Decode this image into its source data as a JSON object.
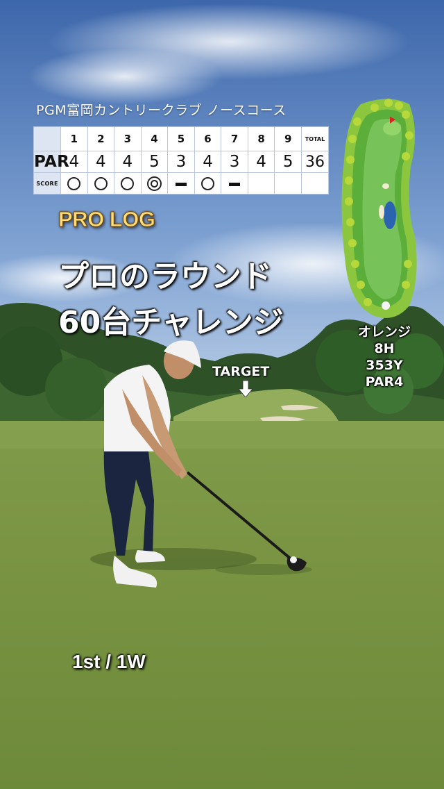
{
  "course": {
    "name": "PGM富岡カントリークラブ ノースコース"
  },
  "scorecard": {
    "labels": {
      "par": "PAR",
      "score": "SCORE",
      "total": "TOTAL"
    },
    "holes": [
      "1",
      "2",
      "3",
      "4",
      "5",
      "6",
      "7",
      "8",
      "9"
    ],
    "par": [
      "4",
      "4",
      "4",
      "5",
      "3",
      "4",
      "3",
      "4",
      "5"
    ],
    "par_total": "36",
    "scores": [
      "par",
      "par",
      "par",
      "birdie",
      "bogey",
      "par",
      "bogey",
      "",
      ""
    ]
  },
  "brand": {
    "logo_text": "PRO LOG"
  },
  "headline": {
    "line1": "プロのラウンド",
    "line2": "60台チャレンジ"
  },
  "hole_info": {
    "name": "オレンジ",
    "hole": "8H",
    "yardage": "353Y",
    "par": "PAR4"
  },
  "target": {
    "label": "TARGET"
  },
  "shot": {
    "label": "1st / 1W"
  },
  "icons": {
    "par_mark": "circle-icon",
    "birdie_mark": "double-circle-icon",
    "bogey_mark": "dash-icon",
    "target_arrow": "arrow-down-icon",
    "hole_map": "hole-map-icon"
  },
  "colors": {
    "sky": "#4f7bb8",
    "fairway": "#6f8f3c",
    "logo_gold": "#ffe07a",
    "scorecard_header": "#dde5f3"
  }
}
